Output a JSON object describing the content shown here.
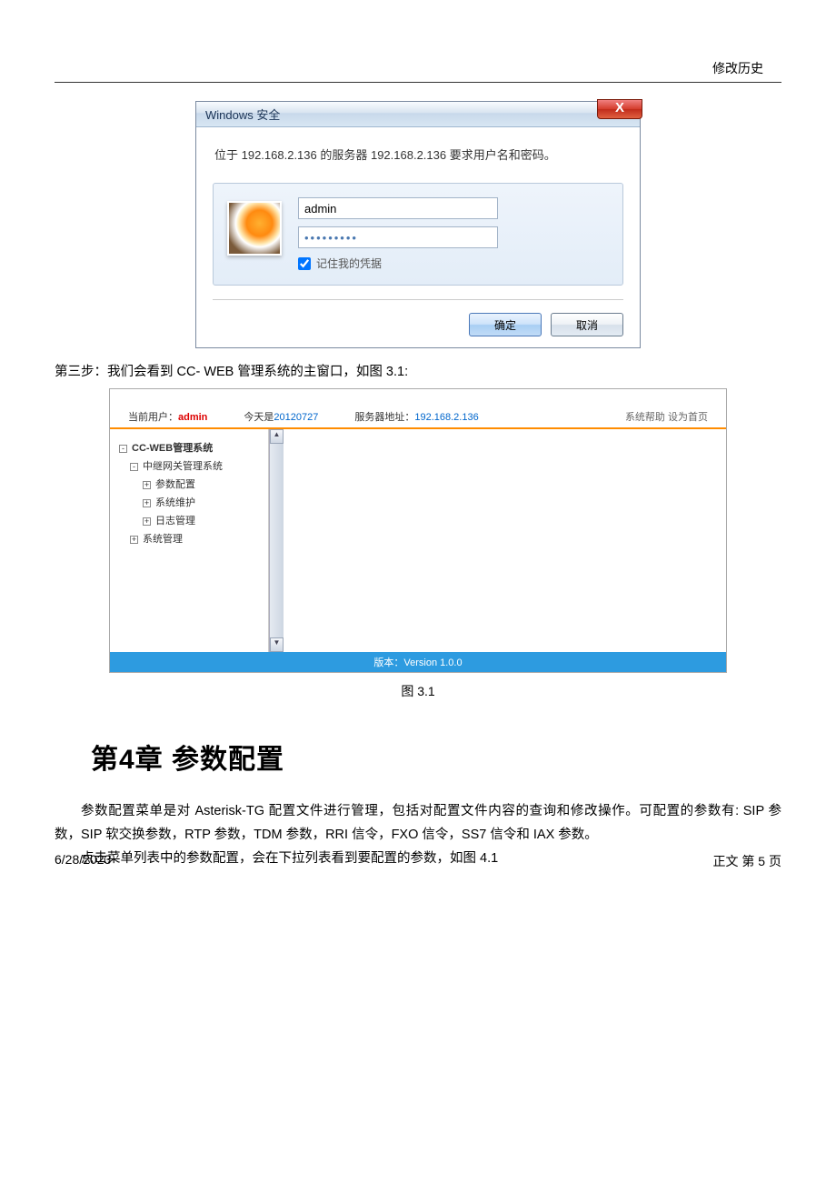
{
  "header": {
    "right": "修改历史"
  },
  "dialog": {
    "title": "Windows 安全",
    "message": "位于 192.168.2.136 的服务器 192.168.2.136 要求用户名和密码。",
    "username": "admin",
    "password_mask": "•••••••••",
    "remember_label": "记住我的凭据",
    "ok_label": "确定",
    "cancel_label": "取消"
  },
  "step3_text": "第三步：我们会看到 CC- WEB 管理系统的主窗口，如图 3.1:",
  "webshot": {
    "user_label": "当前用户：",
    "user_value": "admin",
    "date_label": "今天是",
    "date_value": "20120727",
    "server_label": "服务器地址：",
    "server_value": "192.168.2.136",
    "help_label": "系统帮助",
    "home_label": "设为首页",
    "tree": {
      "root": "CC-WEB管理系统",
      "l2": "中继网关管理系统",
      "l3a": "参数配置",
      "l3b": "系统维护",
      "l3c": "日志管理",
      "l2b": "系统管理"
    },
    "footer_label": "版本：",
    "footer_value": "Version 1.0.0"
  },
  "caption_31": "图 3.1",
  "chapter4": "第4章 参数配置",
  "para1": "参数配置菜单是对 Asterisk-TG 配置文件进行管理，包括对配置文件内容的查询和修改操作。可配置的参数有: SIP 参数，SIP 软交换参数，RTP 参数，TDM 参数，RRI 信令，FXO 信令，SS7 信令和 IAX 参数。",
  "para2": "点击菜单列表中的参数配置，会在下拉列表看到要配置的参数，如图 4.1",
  "footer": {
    "date": "6/28/2023",
    "page": "正文 第 5 页"
  }
}
